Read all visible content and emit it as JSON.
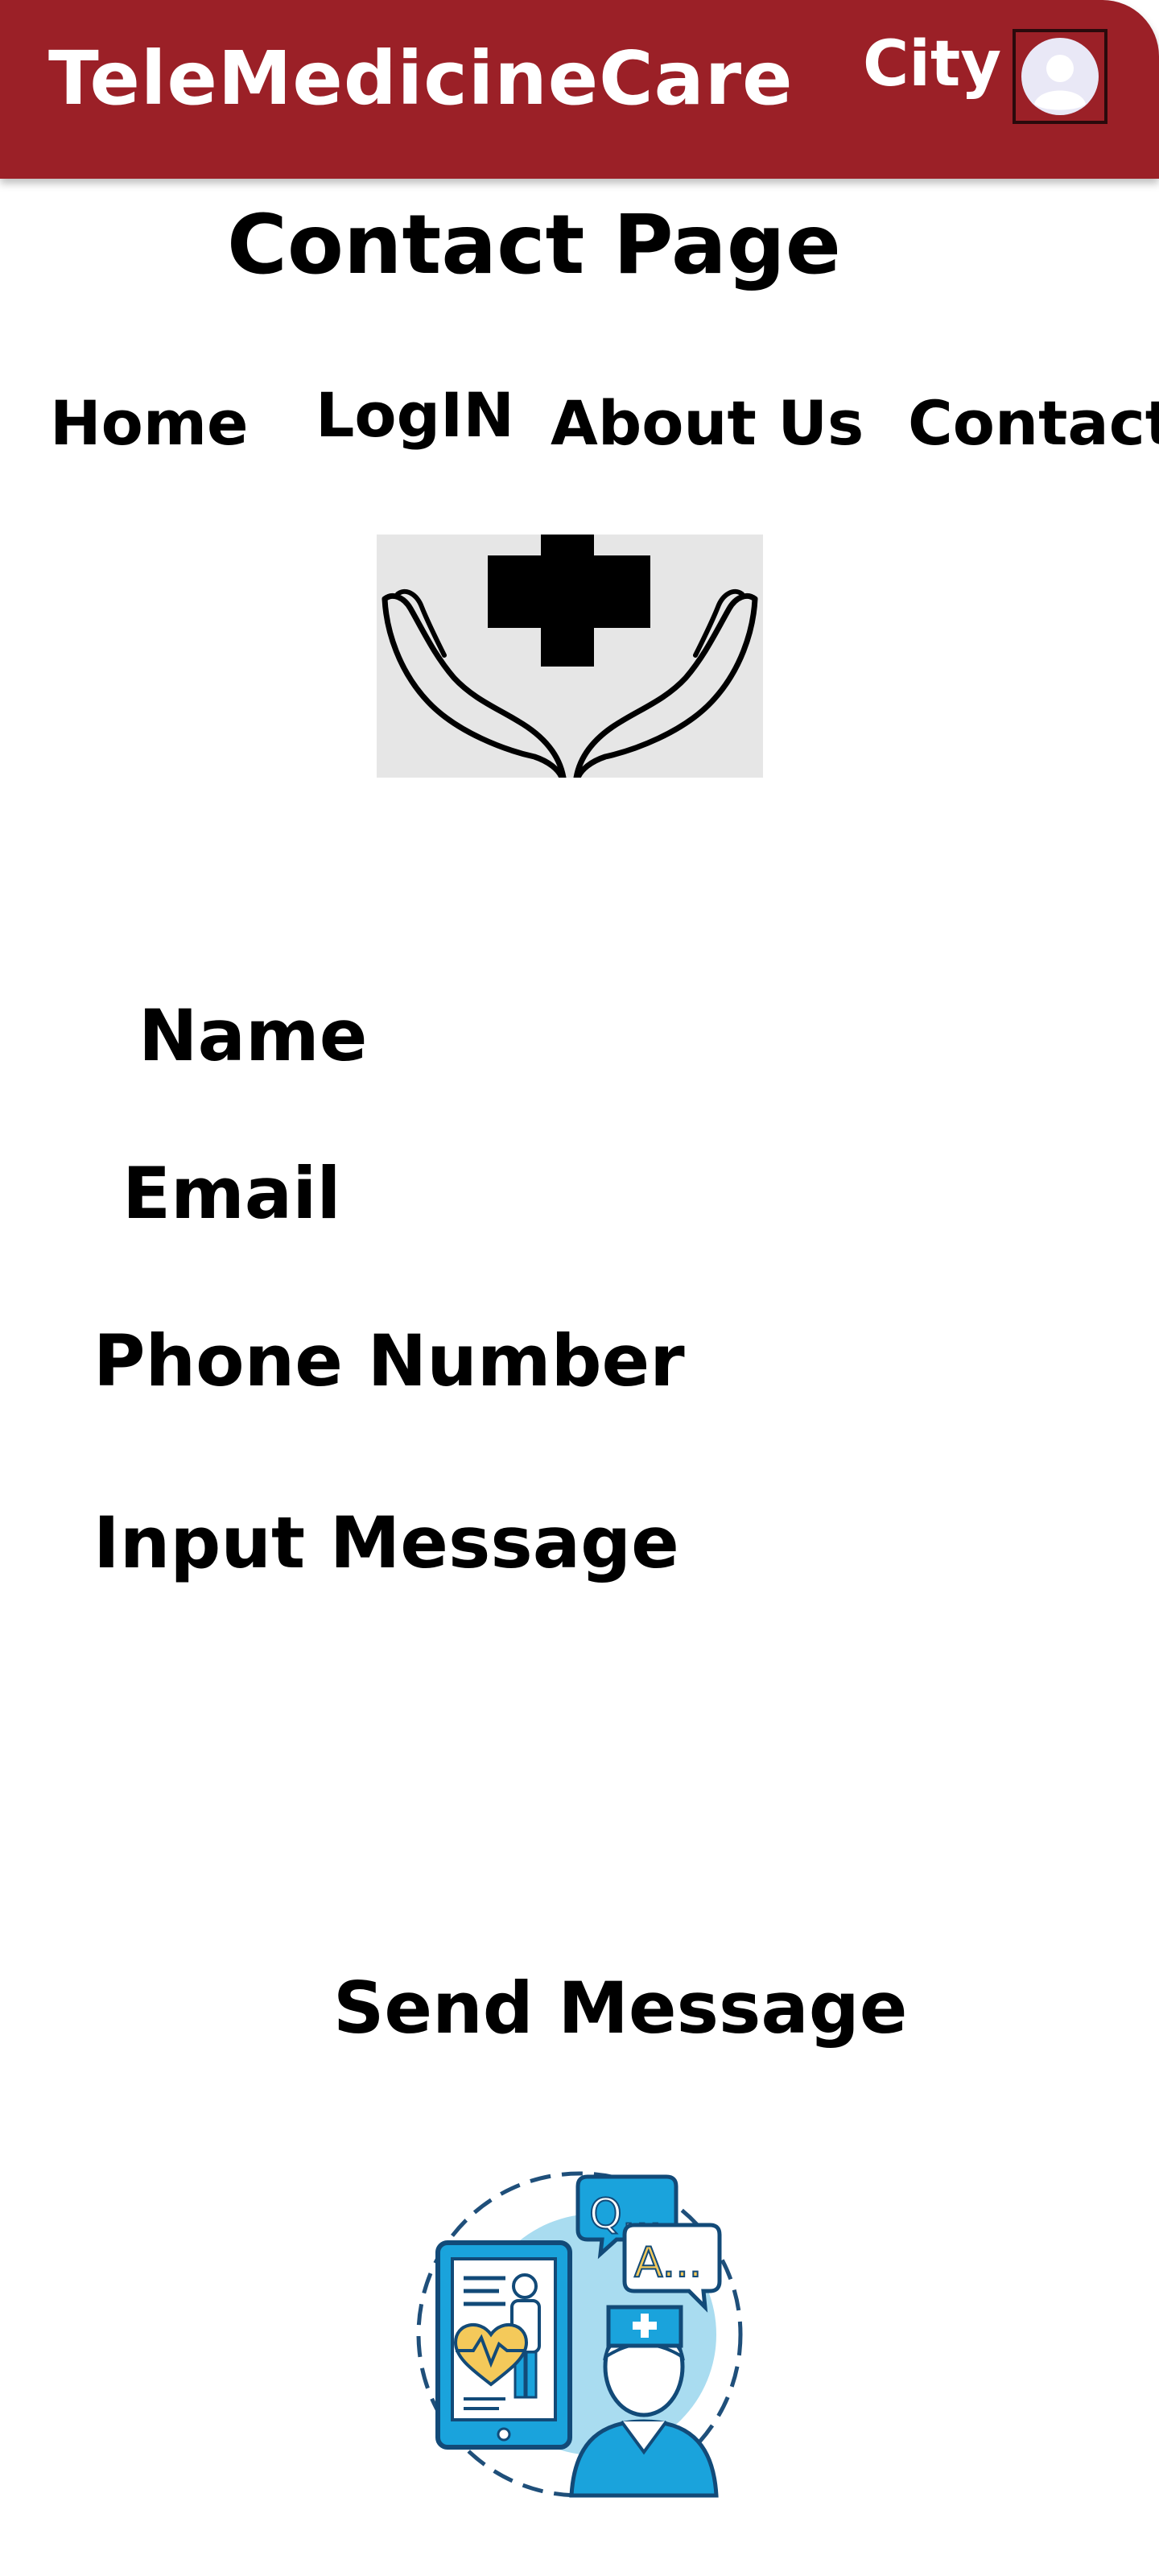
{
  "header": {
    "brand": "TeleMedicineCare",
    "city_label": "City",
    "avatar_icon": "user-avatar-icon",
    "background_color": "#9b2027"
  },
  "page_title": "Contact Page",
  "nav": {
    "items": [
      {
        "label": "Home"
      },
      {
        "label": "LogIN"
      },
      {
        "label": "About Us"
      },
      {
        "label": "Contact"
      }
    ]
  },
  "logo": {
    "icon": "hands-medical-cross-icon"
  },
  "form": {
    "name_label": "Name",
    "email_label": "Email",
    "phone_label": "Phone Number",
    "message_label": "Input Message",
    "submit_label": "Send Message"
  },
  "illustration": {
    "icon": "telemedicine-consultation-icon",
    "bubble_q": "Q...",
    "bubble_a": "A..."
  }
}
